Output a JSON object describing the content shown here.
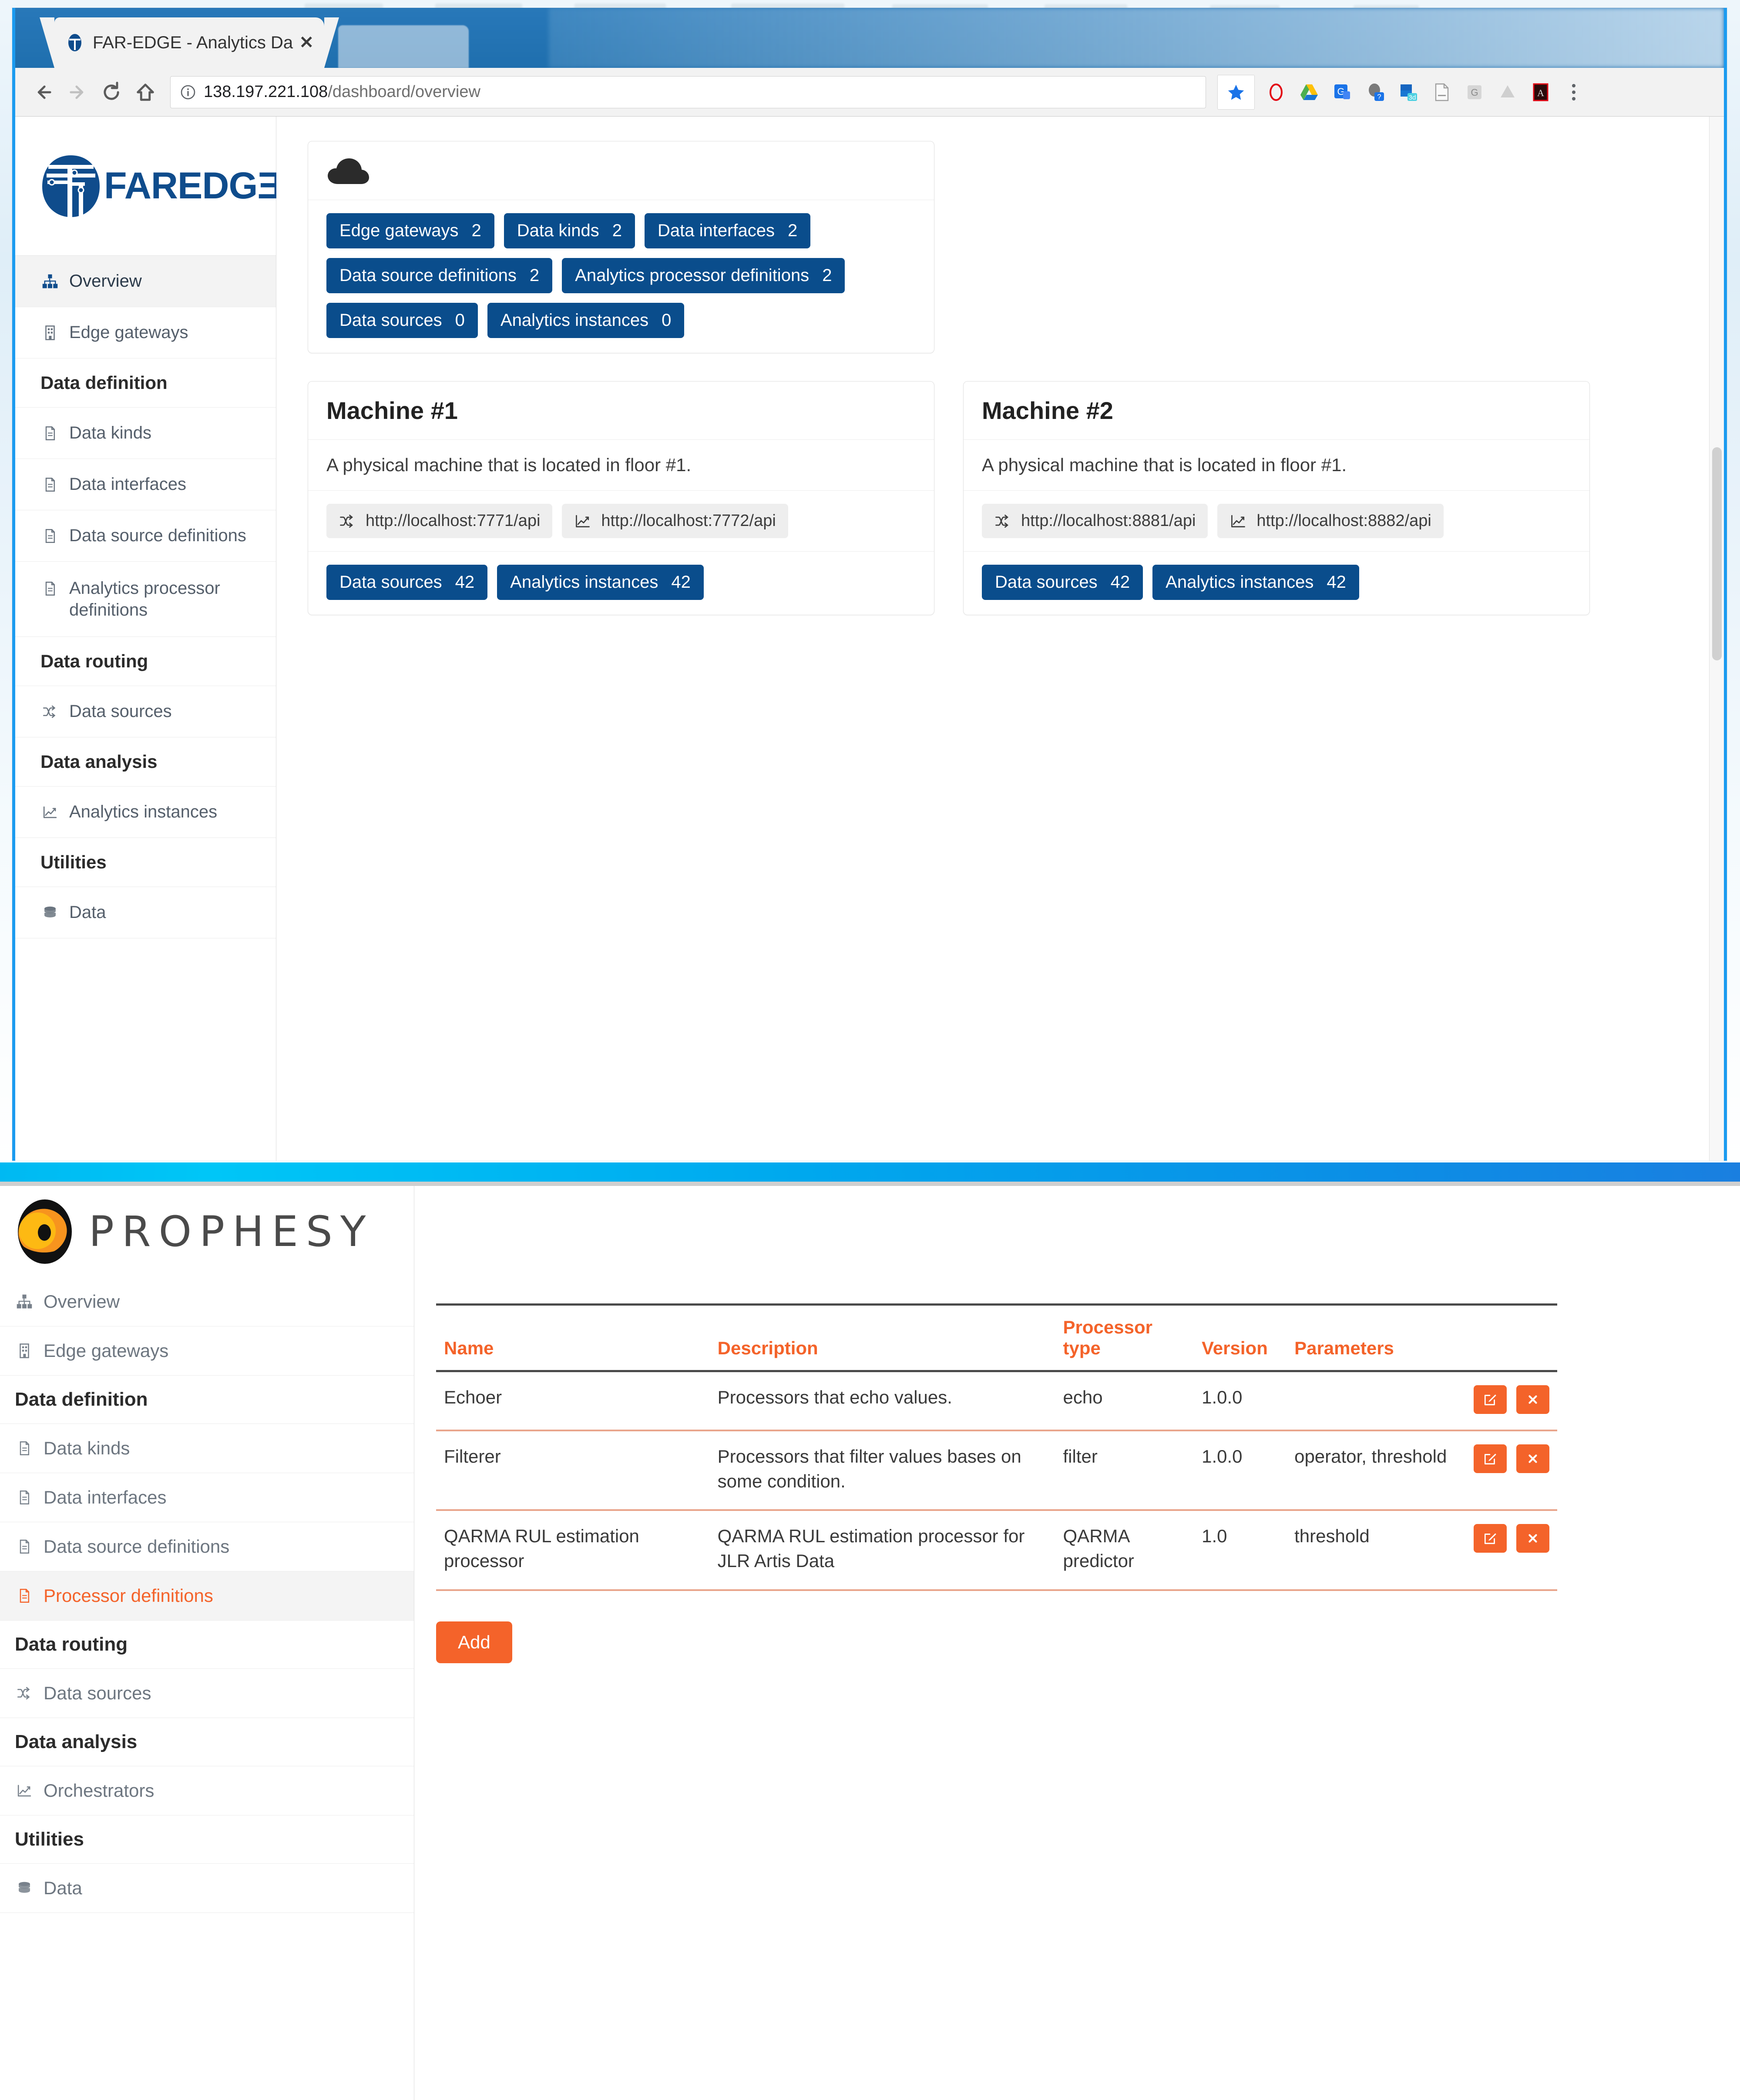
{
  "browser": {
    "tab": {
      "title": "FAR-EDGE - Analytics Da",
      "close_label": "✕",
      "favicon": "far-edge-favicon"
    },
    "nav": {
      "back": "←",
      "forward": "→",
      "reload": "↻",
      "home": "⌂"
    },
    "omnibox": {
      "host": "138.197.221.108",
      "path": "/dashboard/overview",
      "full_url": "138.197.221.108/dashboard/overview",
      "info_icon": "info-circle-icon"
    },
    "toolbar_icons": [
      "bookmark-star-icon",
      "opera-icon",
      "google-drive-icon",
      "google-translate-icon",
      "help-avatar-icon",
      "3d-extension-icon",
      "document-icon",
      "google-g-icon",
      "drive-grey-icon",
      "adobe-acrobat-icon"
    ],
    "menu_icon": "kebab-menu-icon"
  },
  "app_a": {
    "brand": {
      "logo": "far-edge-shield-logo",
      "word": "FAREDGƎ"
    },
    "sidebar": [
      {
        "type": "item",
        "label": "Overview",
        "icon": "sitemap-icon",
        "active": true
      },
      {
        "type": "item",
        "label": "Edge gateways",
        "icon": "building-icon",
        "active": false
      },
      {
        "type": "heading",
        "label": "Data definition"
      },
      {
        "type": "item",
        "label": "Data kinds",
        "icon": "file-icon",
        "active": false
      },
      {
        "type": "item",
        "label": "Data interfaces",
        "icon": "file-icon",
        "active": false
      },
      {
        "type": "item",
        "label": "Data source definitions",
        "icon": "file-icon",
        "active": false
      },
      {
        "type": "item",
        "label": "Analytics processor definitions",
        "icon": "file-icon",
        "active": false
      },
      {
        "type": "heading",
        "label": "Data routing"
      },
      {
        "type": "item",
        "label": "Data sources",
        "icon": "shuffle-icon",
        "active": false
      },
      {
        "type": "heading",
        "label": "Data analysis"
      },
      {
        "type": "item",
        "label": "Analytics instances",
        "icon": "chart-line-icon",
        "active": false
      },
      {
        "type": "heading",
        "label": "Utilities"
      },
      {
        "type": "item",
        "label": "Data",
        "icon": "database-icon",
        "active": false
      }
    ],
    "summary_card": {
      "icon": "cloud-icon",
      "badges": [
        {
          "label": "Edge gateways",
          "count": "2"
        },
        {
          "label": "Data kinds",
          "count": "2"
        },
        {
          "label": "Data interfaces",
          "count": "2"
        },
        {
          "label": "Data source definitions",
          "count": "2"
        },
        {
          "label": "Analytics processor definitions",
          "count": "2"
        },
        {
          "label": "Data sources",
          "count": "0"
        },
        {
          "label": "Analytics instances",
          "count": "0"
        }
      ]
    },
    "machines": [
      {
        "title": "Machine #1",
        "description": "A physical machine that is located in floor #1.",
        "endpoints": [
          {
            "icon": "shuffle-icon",
            "url": "http://localhost:7771/api"
          },
          {
            "icon": "chart-line-icon",
            "url": "http://localhost:7772/api"
          }
        ],
        "badges": [
          {
            "label": "Data sources",
            "count": "42"
          },
          {
            "label": "Analytics instances",
            "count": "42"
          }
        ]
      },
      {
        "title": "Machine #2",
        "description": "A physical machine that is located in floor #1.",
        "endpoints": [
          {
            "icon": "shuffle-icon",
            "url": "http://localhost:8881/api"
          },
          {
            "icon": "chart-line-icon",
            "url": "http://localhost:8882/api"
          }
        ],
        "badges": [
          {
            "label": "Data sources",
            "count": "42"
          },
          {
            "label": "Analytics instances",
            "count": "42"
          }
        ]
      }
    ]
  },
  "app_b": {
    "brand": {
      "logo": "prophesy-eye-logo",
      "word": "PROPHESY"
    },
    "sidebar": [
      {
        "type": "item",
        "label": "Overview",
        "icon": "sitemap-icon",
        "active": false
      },
      {
        "type": "item",
        "label": "Edge gateways",
        "icon": "building-icon",
        "active": false
      },
      {
        "type": "heading",
        "label": "Data definition"
      },
      {
        "type": "item",
        "label": "Data kinds",
        "icon": "file-icon",
        "active": false
      },
      {
        "type": "item",
        "label": "Data interfaces",
        "icon": "file-icon",
        "active": false
      },
      {
        "type": "item",
        "label": "Data source definitions",
        "icon": "file-icon",
        "active": false
      },
      {
        "type": "item",
        "label": "Processor definitions",
        "icon": "file-icon",
        "active": true
      },
      {
        "type": "heading",
        "label": "Data routing"
      },
      {
        "type": "item",
        "label": "Data sources",
        "icon": "shuffle-icon",
        "active": false
      },
      {
        "type": "heading",
        "label": "Data analysis"
      },
      {
        "type": "item",
        "label": "Orchestrators",
        "icon": "chart-line-icon",
        "active": false
      },
      {
        "type": "heading",
        "label": "Utilities"
      },
      {
        "type": "item",
        "label": "Data",
        "icon": "database-icon",
        "active": false
      }
    ],
    "table": {
      "columns": [
        "Name",
        "Description",
        "Processor type",
        "Version",
        "Parameters",
        ""
      ],
      "rows": [
        {
          "name": "Echoer",
          "description": "Processors that echo values.",
          "processor_type": "echo",
          "version": "1.0.0",
          "parameters": ""
        },
        {
          "name": "Filterer",
          "description": "Processors that filter values bases on some condition.",
          "processor_type": "filter",
          "version": "1.0.0",
          "parameters": "operator, threshold"
        },
        {
          "name": "QARMA RUL estimation processor",
          "description": "QARMA RUL estimation processor for JLR Artis Data",
          "processor_type": "QARMA predictor",
          "version": "1.0",
          "parameters": "threshold"
        }
      ],
      "row_actions": {
        "edit_icon": "edit-pencil-icon",
        "delete_icon": "delete-x-icon"
      }
    },
    "add_button": "Add"
  },
  "colors": {
    "badge_blue": "#0a4d8c",
    "brand_blue": "#0f4c8c",
    "accent_orange": "#f4632a",
    "browser_frame_blue": "#1b9bf0"
  }
}
